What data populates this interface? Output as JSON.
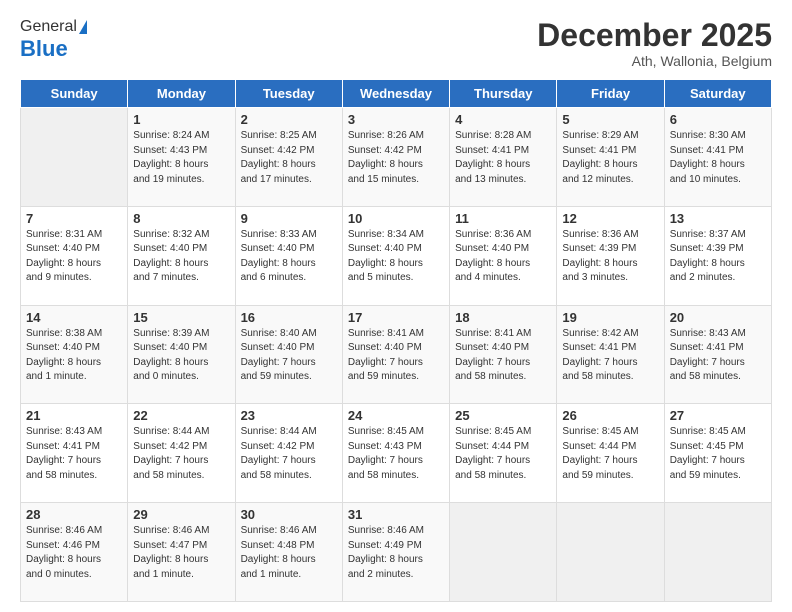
{
  "logo": {
    "general": "General",
    "blue": "Blue"
  },
  "header": {
    "month": "December 2025",
    "location": "Ath, Wallonia, Belgium"
  },
  "weekdays": [
    "Sunday",
    "Monday",
    "Tuesday",
    "Wednesday",
    "Thursday",
    "Friday",
    "Saturday"
  ],
  "weeks": [
    [
      {
        "day": "",
        "info": ""
      },
      {
        "day": "1",
        "info": "Sunrise: 8:24 AM\nSunset: 4:43 PM\nDaylight: 8 hours\nand 19 minutes."
      },
      {
        "day": "2",
        "info": "Sunrise: 8:25 AM\nSunset: 4:42 PM\nDaylight: 8 hours\nand 17 minutes."
      },
      {
        "day": "3",
        "info": "Sunrise: 8:26 AM\nSunset: 4:42 PM\nDaylight: 8 hours\nand 15 minutes."
      },
      {
        "day": "4",
        "info": "Sunrise: 8:28 AM\nSunset: 4:41 PM\nDaylight: 8 hours\nand 13 minutes."
      },
      {
        "day": "5",
        "info": "Sunrise: 8:29 AM\nSunset: 4:41 PM\nDaylight: 8 hours\nand 12 minutes."
      },
      {
        "day": "6",
        "info": "Sunrise: 8:30 AM\nSunset: 4:41 PM\nDaylight: 8 hours\nand 10 minutes."
      }
    ],
    [
      {
        "day": "7",
        "info": "Sunrise: 8:31 AM\nSunset: 4:40 PM\nDaylight: 8 hours\nand 9 minutes."
      },
      {
        "day": "8",
        "info": "Sunrise: 8:32 AM\nSunset: 4:40 PM\nDaylight: 8 hours\nand 7 minutes."
      },
      {
        "day": "9",
        "info": "Sunrise: 8:33 AM\nSunset: 4:40 PM\nDaylight: 8 hours\nand 6 minutes."
      },
      {
        "day": "10",
        "info": "Sunrise: 8:34 AM\nSunset: 4:40 PM\nDaylight: 8 hours\nand 5 minutes."
      },
      {
        "day": "11",
        "info": "Sunrise: 8:36 AM\nSunset: 4:40 PM\nDaylight: 8 hours\nand 4 minutes."
      },
      {
        "day": "12",
        "info": "Sunrise: 8:36 AM\nSunset: 4:39 PM\nDaylight: 8 hours\nand 3 minutes."
      },
      {
        "day": "13",
        "info": "Sunrise: 8:37 AM\nSunset: 4:39 PM\nDaylight: 8 hours\nand 2 minutes."
      }
    ],
    [
      {
        "day": "14",
        "info": "Sunrise: 8:38 AM\nSunset: 4:40 PM\nDaylight: 8 hours\nand 1 minute."
      },
      {
        "day": "15",
        "info": "Sunrise: 8:39 AM\nSunset: 4:40 PM\nDaylight: 8 hours\nand 0 minutes."
      },
      {
        "day": "16",
        "info": "Sunrise: 8:40 AM\nSunset: 4:40 PM\nDaylight: 7 hours\nand 59 minutes."
      },
      {
        "day": "17",
        "info": "Sunrise: 8:41 AM\nSunset: 4:40 PM\nDaylight: 7 hours\nand 59 minutes."
      },
      {
        "day": "18",
        "info": "Sunrise: 8:41 AM\nSunset: 4:40 PM\nDaylight: 7 hours\nand 58 minutes."
      },
      {
        "day": "19",
        "info": "Sunrise: 8:42 AM\nSunset: 4:41 PM\nDaylight: 7 hours\nand 58 minutes."
      },
      {
        "day": "20",
        "info": "Sunrise: 8:43 AM\nSunset: 4:41 PM\nDaylight: 7 hours\nand 58 minutes."
      }
    ],
    [
      {
        "day": "21",
        "info": "Sunrise: 8:43 AM\nSunset: 4:41 PM\nDaylight: 7 hours\nand 58 minutes."
      },
      {
        "day": "22",
        "info": "Sunrise: 8:44 AM\nSunset: 4:42 PM\nDaylight: 7 hours\nand 58 minutes."
      },
      {
        "day": "23",
        "info": "Sunrise: 8:44 AM\nSunset: 4:42 PM\nDaylight: 7 hours\nand 58 minutes."
      },
      {
        "day": "24",
        "info": "Sunrise: 8:45 AM\nSunset: 4:43 PM\nDaylight: 7 hours\nand 58 minutes."
      },
      {
        "day": "25",
        "info": "Sunrise: 8:45 AM\nSunset: 4:44 PM\nDaylight: 7 hours\nand 58 minutes."
      },
      {
        "day": "26",
        "info": "Sunrise: 8:45 AM\nSunset: 4:44 PM\nDaylight: 7 hours\nand 59 minutes."
      },
      {
        "day": "27",
        "info": "Sunrise: 8:45 AM\nSunset: 4:45 PM\nDaylight: 7 hours\nand 59 minutes."
      }
    ],
    [
      {
        "day": "28",
        "info": "Sunrise: 8:46 AM\nSunset: 4:46 PM\nDaylight: 8 hours\nand 0 minutes."
      },
      {
        "day": "29",
        "info": "Sunrise: 8:46 AM\nSunset: 4:47 PM\nDaylight: 8 hours\nand 1 minute."
      },
      {
        "day": "30",
        "info": "Sunrise: 8:46 AM\nSunset: 4:48 PM\nDaylight: 8 hours\nand 1 minute."
      },
      {
        "day": "31",
        "info": "Sunrise: 8:46 AM\nSunset: 4:49 PM\nDaylight: 8 hours\nand 2 minutes."
      },
      {
        "day": "",
        "info": ""
      },
      {
        "day": "",
        "info": ""
      },
      {
        "day": "",
        "info": ""
      }
    ]
  ]
}
